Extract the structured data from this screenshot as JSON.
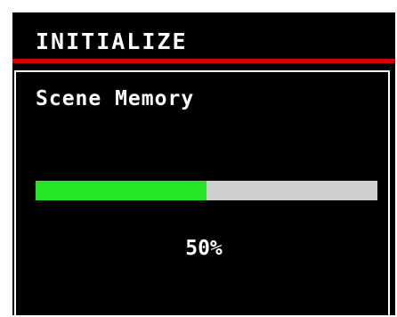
{
  "header": {
    "title": "INITIALIZE",
    "accent_color": "#d40000"
  },
  "panel": {
    "title": "Scene Memory",
    "progress": {
      "value_fraction": 0.5,
      "label": "50%",
      "fill_color": "#26e526",
      "track_color": "#cfcfcf"
    }
  }
}
